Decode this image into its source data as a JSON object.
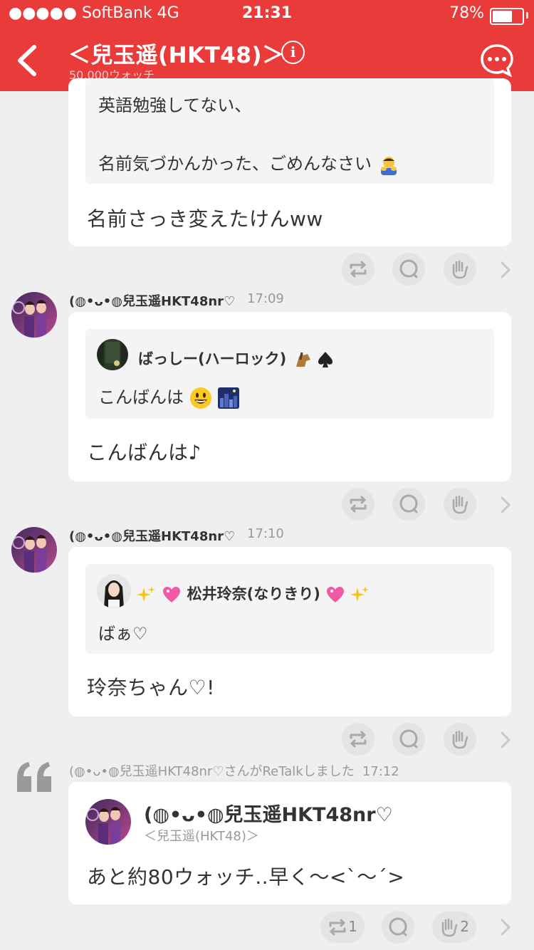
{
  "status": {
    "carrier": "●●●●● SoftBank  4G",
    "time": "21:31",
    "battery": "78%",
    "battery_level": 0.78
  },
  "header": {
    "title": "＜兒玉遥(HKT48)＞",
    "watch_count": "50,000ウォッチ",
    "info_symbol": "i"
  },
  "posts": [
    {
      "quote_lines": [
        "英語勉強してない、",
        "名前気づかんかった、ごめんなさい"
      ],
      "text": "名前さっき変えたけんww"
    },
    {
      "author": "(◍•ᴗ•◍兒玉遥HKT48nr♡",
      "time": "17:09",
      "quote_author": "ばっしー(ハーロック)",
      "quote_text": "こんばんは",
      "text": "こんばんは♪"
    },
    {
      "author": "(◍•ᴗ•◍兒玉遥HKT48nr♡",
      "time": "17:10",
      "quote_author": "松井玲奈(なりきり)",
      "quote_text": "ばぁ♡",
      "text": "玲奈ちゃん♡!"
    }
  ],
  "retalk": {
    "notice": "(◍•ᴗ•◍兒玉遥HKT48nr♡さんがReTalkしました",
    "time": "17:12",
    "author": "(◍•ᴗ•◍兒玉遥HKT48nr♡",
    "room": "＜兒玉遥(HKT48)＞",
    "text": "あと約80ウォッチ‥早く〜<`〜´>",
    "retalk_count": "1",
    "like_count": "2"
  },
  "icons": [
    "back-icon",
    "info-icon",
    "comment-icon",
    "retalk-icon",
    "reply-icon",
    "like-hand-icon",
    "chevron-right-icon",
    "quote-mark-icon"
  ],
  "colors": {
    "header": "#e93c3a",
    "background": "#efeff1",
    "card": "#ffffff"
  }
}
